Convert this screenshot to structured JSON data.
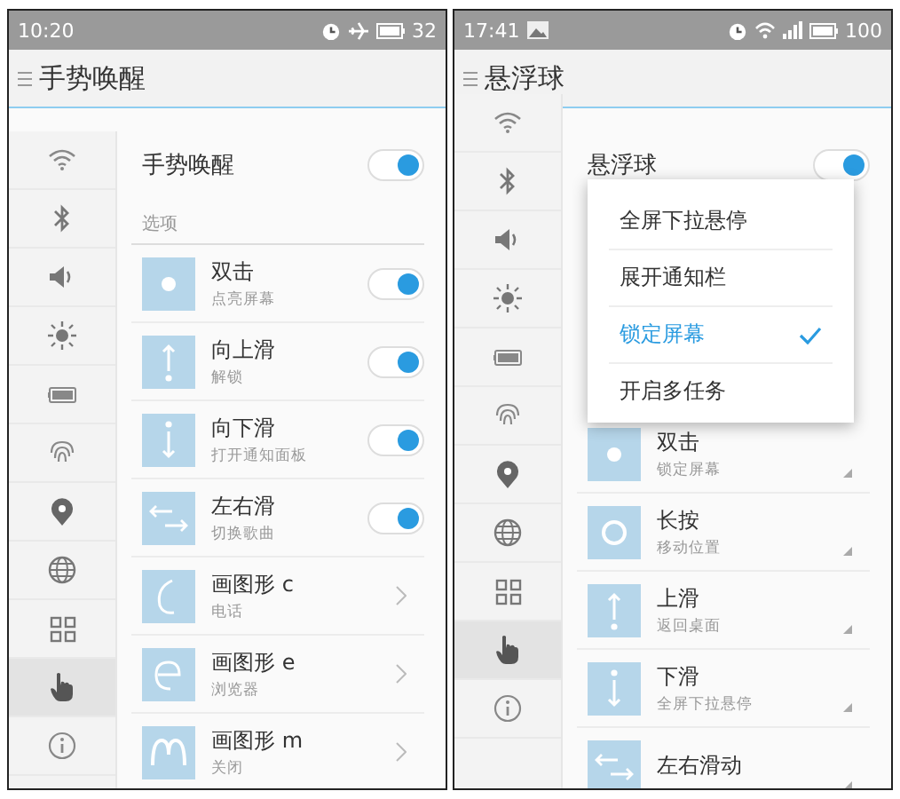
{
  "screens": [
    {
      "status_bar": {
        "time": "10:20",
        "icons": [
          {
            "kind": "alarm"
          },
          {
            "kind": "airplane"
          },
          {
            "kind": "battery"
          }
        ],
        "battery": "32"
      },
      "header": {
        "title": "手势唤醒"
      },
      "sidebar": [
        {
          "kind": "wifi",
          "selected": false
        },
        {
          "kind": "bluetooth",
          "selected": false
        },
        {
          "kind": "sound",
          "selected": false
        },
        {
          "kind": "brightness",
          "selected": false
        },
        {
          "kind": "battery",
          "selected": false
        },
        {
          "kind": "fingerprint",
          "selected": false
        },
        {
          "kind": "location",
          "selected": false
        },
        {
          "kind": "globe",
          "selected": false
        },
        {
          "kind": "grid",
          "selected": false
        },
        {
          "kind": "hand",
          "selected": true
        },
        {
          "kind": "info",
          "selected": false
        }
      ],
      "master": {
        "label": "手势唤醒",
        "on": true
      },
      "section": "选项",
      "items": [
        {
          "kind": "toggle",
          "gesture": {
            "kind": "dot"
          },
          "title": "双击",
          "subtitle": "点亮屏幕",
          "on": true
        },
        {
          "kind": "toggle",
          "gesture": {
            "kind": "up"
          },
          "title": "向上滑",
          "subtitle": "解锁",
          "on": true
        },
        {
          "kind": "toggle",
          "gesture": {
            "kind": "down"
          },
          "title": "向下滑",
          "subtitle": "打开通知面板",
          "on": true
        },
        {
          "kind": "toggle",
          "gesture": {
            "kind": "leftright"
          },
          "title": "左右滑",
          "subtitle": "切换歌曲",
          "on": true
        },
        {
          "kind": "link",
          "gesture": {
            "kind": "c"
          },
          "title": "画图形 c",
          "subtitle": "电话"
        },
        {
          "kind": "link",
          "gesture": {
            "kind": "e"
          },
          "title": "画图形 e",
          "subtitle": "浏览器"
        },
        {
          "kind": "link",
          "gesture": {
            "kind": "m"
          },
          "title": "画图形 m",
          "subtitle": "关闭"
        }
      ]
    },
    {
      "status_bar": {
        "time": "17:41",
        "icons": [
          {
            "kind": "picture"
          },
          {
            "kind": "alarm"
          },
          {
            "kind": "wifi"
          },
          {
            "kind": "signal"
          },
          {
            "kind": "battery"
          }
        ],
        "battery": "100"
      },
      "header": {
        "title": "悬浮球"
      },
      "sidebar": [
        {
          "kind": "wifi",
          "selected": false
        },
        {
          "kind": "bluetooth",
          "selected": false
        },
        {
          "kind": "sound",
          "selected": false
        },
        {
          "kind": "brightness",
          "selected": false
        },
        {
          "kind": "battery",
          "selected": false
        },
        {
          "kind": "fingerprint",
          "selected": false
        },
        {
          "kind": "location",
          "selected": false
        },
        {
          "kind": "globe",
          "selected": false
        },
        {
          "kind": "grid",
          "selected": false
        },
        {
          "kind": "hand",
          "selected": true
        },
        {
          "kind": "info",
          "selected": false
        }
      ],
      "master": {
        "label": "悬浮球",
        "on": true
      },
      "menu": {
        "options": [
          {
            "label": "全屏下拉悬停",
            "selected": false
          },
          {
            "label": "展开通知栏",
            "selected": false
          },
          {
            "label": "锁定屏幕",
            "selected": true
          },
          {
            "label": "开启多任务",
            "selected": false
          }
        ]
      },
      "items": [
        {
          "kind": "select",
          "gesture": {
            "kind": "dot"
          },
          "title": "双击",
          "subtitle": "锁定屏幕"
        },
        {
          "kind": "select",
          "gesture": {
            "kind": "ring"
          },
          "title": "长按",
          "subtitle": "移动位置"
        },
        {
          "kind": "select",
          "gesture": {
            "kind": "up"
          },
          "title": "上滑",
          "subtitle": "返回桌面"
        },
        {
          "kind": "select",
          "gesture": {
            "kind": "down"
          },
          "title": "下滑",
          "subtitle": "全屏下拉悬停"
        },
        {
          "kind": "select",
          "gesture": {
            "kind": "leftright"
          },
          "title": "左右滑动"
        }
      ]
    }
  ]
}
